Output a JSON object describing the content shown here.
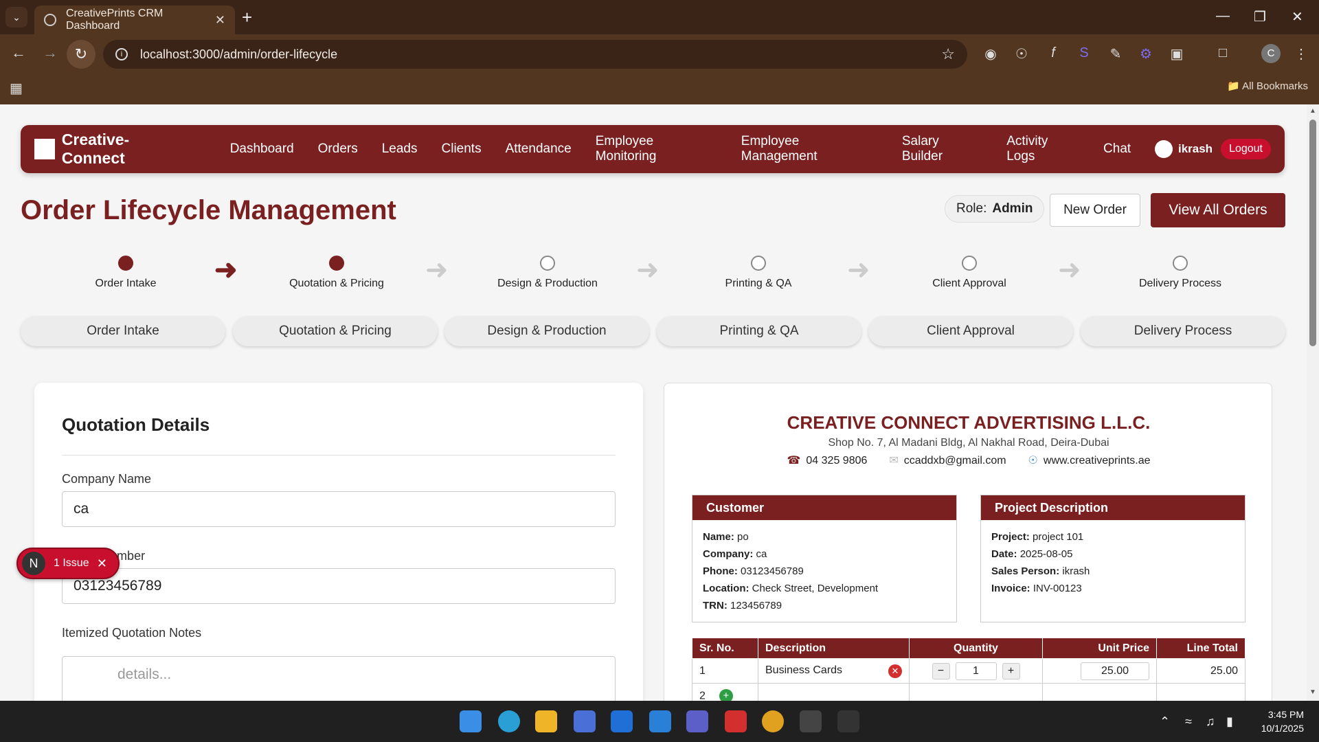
{
  "browser": {
    "tab_title": "CreativePrints CRM Dashboard",
    "url": "localhost:3000/admin/order-lifecycle",
    "all_bookmarks": "All Bookmarks",
    "avatar_letter": "C"
  },
  "nav": {
    "brand": "Creative-Connect",
    "links": [
      "Dashboard",
      "Orders",
      "Leads",
      "Clients",
      "Attendance",
      "Employee Monitoring",
      "Employee Management",
      "Salary Builder",
      "Activity Logs",
      "Chat"
    ],
    "user": "ikrash",
    "logout": "Logout"
  },
  "header": {
    "title": "Order Lifecycle Management",
    "role_label": "Role:",
    "role_value": "Admin",
    "new_order": "New Order",
    "view_all": "View All Orders"
  },
  "stepper": {
    "steps": [
      "Order Intake",
      "Quotation & Pricing",
      "Design & Production",
      "Printing & QA",
      "Client Approval",
      "Delivery Process"
    ],
    "completed_count": 2
  },
  "tabs": [
    "Order Intake",
    "Quotation & Pricing",
    "Design & Production",
    "Printing & QA",
    "Client Approval",
    "Delivery Process"
  ],
  "form": {
    "heading": "Quotation Details",
    "company_label": "Company Name",
    "company_value": "ca",
    "phone_label": "Phone Number",
    "phone_value": "03123456789",
    "notes_label": "Itemized Quotation Notes",
    "notes_placeholder": "details..."
  },
  "issue": {
    "letter": "N",
    "text": "1 Issue"
  },
  "invoice": {
    "company": "CREATIVE CONNECT ADVERTISING L.L.C.",
    "address": "Shop No. 7, Al Madani Bldg, Al Nakhal Road, Deira-Dubai",
    "phone": "04 325 9806",
    "email": "ccaddxb@gmail.com",
    "website": "www.creativeprints.ae",
    "customer": {
      "heading": "Customer",
      "name_label": "Name:",
      "name": "po",
      "company_label": "Company:",
      "company": "ca",
      "phone_label": "Phone:",
      "phone": "03123456789",
      "location_label": "Location:",
      "location": "Check Street, Development",
      "trn_label": "TRN:",
      "trn": "123456789"
    },
    "project": {
      "heading": "Project Description",
      "project_label": "Project:",
      "project": "project 101",
      "date_label": "Date:",
      "date": "2025-08-05",
      "sales_label": "Sales Person:",
      "sales": "ikrash",
      "invoice_label": "Invoice:",
      "invoice": "INV-00123"
    },
    "table": {
      "headers": [
        "Sr. No.",
        "Description",
        "Quantity",
        "Unit Price",
        "Line Total"
      ],
      "rows": [
        {
          "sr": "1",
          "desc": "Business Cards",
          "qty": "1",
          "price": "25.00",
          "total": "25.00"
        },
        {
          "sr": "2"
        }
      ]
    }
  },
  "clock": {
    "time": "3:45 PM",
    "date": "10/1/2025"
  },
  "colors": {
    "brand": "#7a2020",
    "danger": "#c8102e"
  }
}
